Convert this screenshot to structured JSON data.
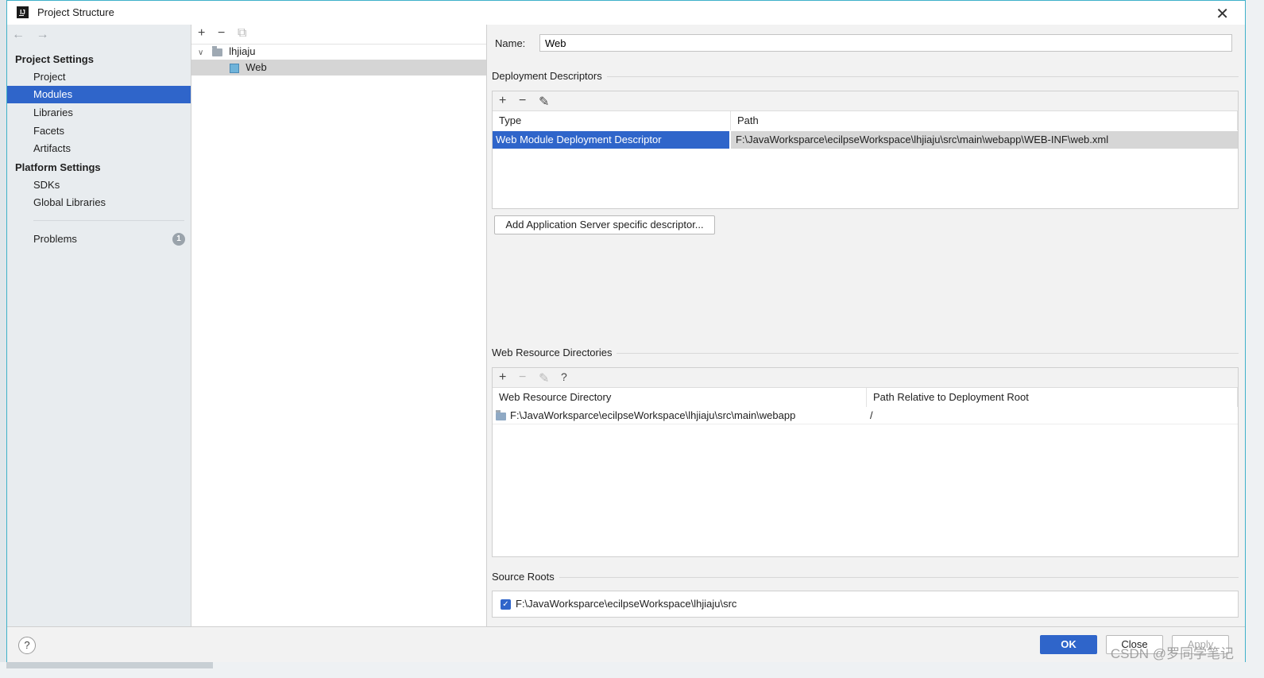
{
  "window": {
    "title": "Project Structure",
    "logo_text": "IJ",
    "close_glyph": "✕"
  },
  "nav": {
    "back_glyph": "←",
    "forward_glyph": "→",
    "project_settings_heading": "Project Settings",
    "project_items": [
      "Project",
      "Modules",
      "Libraries",
      "Facets",
      "Artifacts"
    ],
    "selected_item": "Modules",
    "platform_settings_heading": "Platform Settings",
    "platform_items": [
      "SDKs",
      "Global Libraries"
    ],
    "problems_label": "Problems",
    "problems_count": "1"
  },
  "tree": {
    "toolbar": {
      "add": "+",
      "remove": "−",
      "copy": "⧉"
    },
    "root": {
      "label": "lhjiaju",
      "expanded_glyph": "∨"
    },
    "child": {
      "label": "Web",
      "selected": true
    }
  },
  "detail": {
    "name_label": "Name:",
    "name_value": "Web",
    "deployment": {
      "title": "Deployment Descriptors",
      "toolbar": {
        "add": "+",
        "remove": "−",
        "edit": "✎"
      },
      "columns": [
        "Type",
        "Path"
      ],
      "rows": [
        {
          "type": "Web Module Deployment Descriptor",
          "path": "F:\\JavaWorksparce\\ecilpseWorkspace\\lhjiaju\\src\\main\\webapp\\WEB-INF\\web.xml"
        }
      ],
      "add_server_button": "Add Application Server specific descriptor..."
    },
    "resources": {
      "title": "Web Resource Directories",
      "toolbar": {
        "add": "+",
        "remove": "−",
        "edit": "✎",
        "help": "?"
      },
      "columns": [
        "Web Resource Directory",
        "Path Relative to Deployment Root"
      ],
      "rows": [
        {
          "directory": "F:\\JavaWorksparce\\ecilpseWorkspace\\lhjiaju\\src\\main\\webapp",
          "relative": "/"
        }
      ]
    },
    "source_roots": {
      "title": "Source Roots",
      "items": [
        {
          "checked": true,
          "path": "F:\\JavaWorksparce\\ecilpseWorkspace\\lhjiaju\\src"
        }
      ]
    }
  },
  "footer": {
    "help": "?",
    "ok": "OK",
    "close": "Close",
    "apply": "Apply",
    "watermark": "CSDN @罗同学笔记"
  },
  "colors": {
    "accent": "#2f65ca",
    "window_border": "#3fb1c9"
  }
}
